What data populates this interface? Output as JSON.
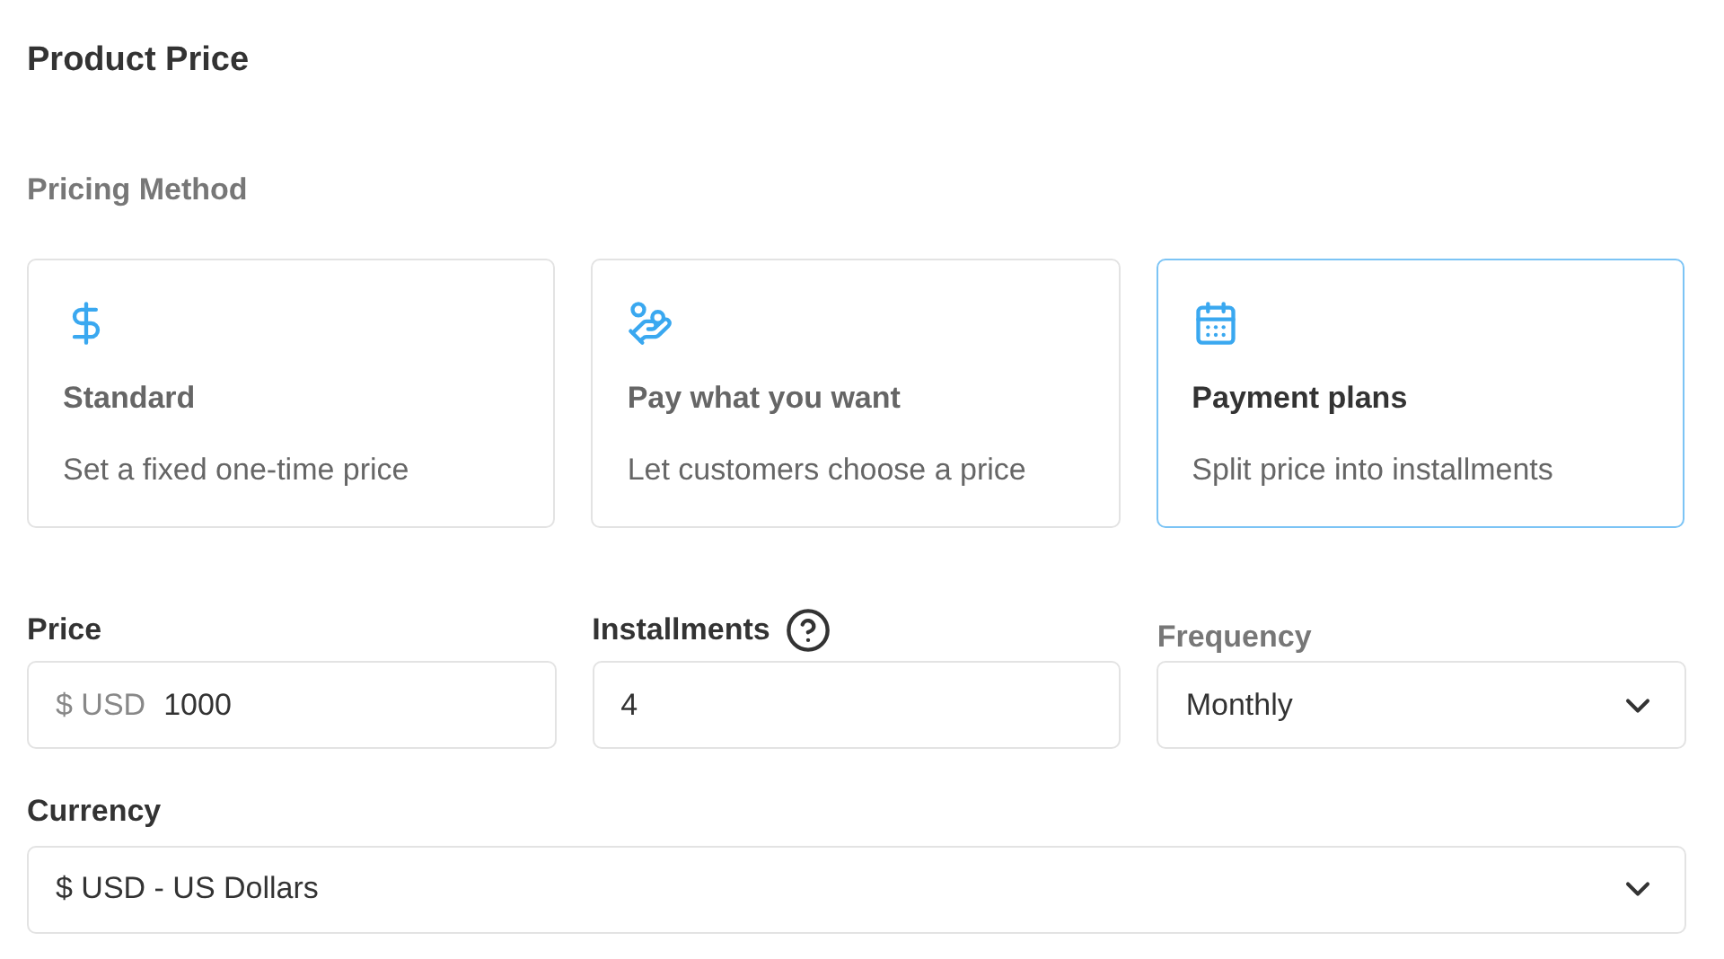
{
  "title": "Product Price",
  "pricing_method": {
    "label": "Pricing Method",
    "options": [
      {
        "title": "Standard",
        "description": "Set a fixed one-time price",
        "selected": false
      },
      {
        "title": "Pay what you want",
        "description": "Let customers choose a price",
        "selected": false
      },
      {
        "title": "Payment plans",
        "description": "Split price into installments",
        "selected": true
      }
    ]
  },
  "price": {
    "label": "Price",
    "prefix": "$ USD",
    "value": "1000"
  },
  "installments": {
    "label": "Installments",
    "value": "4"
  },
  "frequency": {
    "label": "Frequency",
    "value": "Monthly"
  },
  "currency": {
    "label": "Currency",
    "value": "$ USD - US Dollars"
  }
}
